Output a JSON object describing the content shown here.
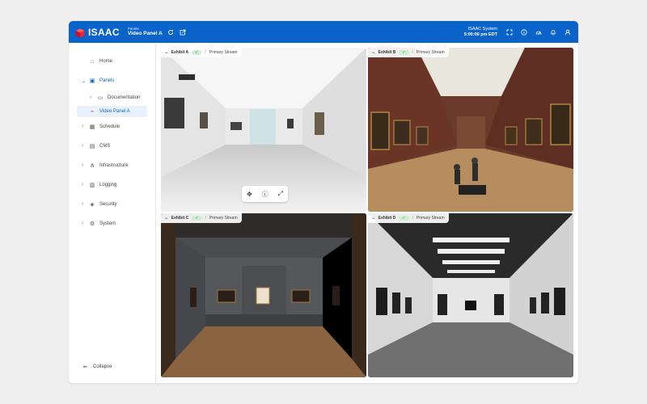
{
  "header": {
    "logo_text": "ISAAC",
    "breadcrumb_parent": "Panels",
    "title": "Video Panel A",
    "system_name": "ISAAC System",
    "time": "5:00:00 pm EDT"
  },
  "sidebar": {
    "items": [
      {
        "label": "Home"
      },
      {
        "label": "Panels"
      },
      {
        "label": "Documentation"
      },
      {
        "label": "Video Panel A"
      },
      {
        "label": "Schedule"
      },
      {
        "label": "CMS"
      },
      {
        "label": "Infrastructure"
      },
      {
        "label": "Logging"
      },
      {
        "label": "Security"
      },
      {
        "label": "System"
      }
    ],
    "collapse_label": "Collapse"
  },
  "tiles": [
    {
      "name": "Exhibit A",
      "stream": "Primary Stream"
    },
    {
      "name": "Exhibit B",
      "stream": "Primary Stream"
    },
    {
      "name": "Exhibit C",
      "stream": "Primary Stream"
    },
    {
      "name": "Exhibit D",
      "stream": "Primary Stream"
    }
  ],
  "colors": {
    "brand": "#0a63c9",
    "status_ok": "#2e8b3d",
    "status_ok_bg": "#cfeed3"
  }
}
